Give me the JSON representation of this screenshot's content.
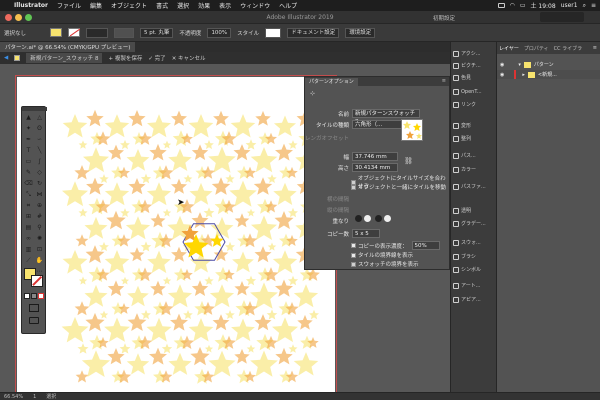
{
  "menubar": {
    "app_name": "Illustrator",
    "items": [
      "ファイル",
      "編集",
      "オブジェクト",
      "書式",
      "選択",
      "効果",
      "表示",
      "ウィンドウ",
      "ヘルプ"
    ],
    "clock": "土 19:08",
    "user": "user1"
  },
  "window": {
    "title": "Adobe Illustrator 2019"
  },
  "control_bar": {
    "selection_label": "選択なし",
    "stroke_weight": "5 pt. 丸筆",
    "opacity_label": "不透明度",
    "opacity_value": "100%",
    "style_label": "スタイル",
    "doc_setup": "ドキュメント設定",
    "prefs": "環境設定",
    "workspace": "初期設定"
  },
  "document_tab": {
    "title": "パターン.ai* @ 66.54% (CMYK/GPU プレビュー)"
  },
  "isolation_bar": {
    "pattern_name": "新規パターン_スウォッチ 8",
    "save_copy": "+ 複製を保存",
    "done": "✓ 完了",
    "cancel": "✕ キャンセル"
  },
  "pattern_options": {
    "tab_label": "パターンオプション",
    "name_label": "名前",
    "name_value": "新規パターンスウォッチ 8",
    "tile_type_label": "タイルの種類",
    "tile_type_value": "六角形（...",
    "brick_offset_label": "レンガオフセット",
    "width_label": "幅",
    "width_value": "37.746 mm",
    "height_label": "高さ",
    "height_value": "30.4134 mm",
    "size_tile_check": "オブジェクトにタイルサイズを合わせる",
    "move_tile_check": "オブジェクトと一緒にタイルを移動",
    "h_spacing_label": "横の間隔",
    "v_spacing_label": "縦の間隔",
    "overlap_label": "重なり",
    "copies_label": "コピー数",
    "copies_value": "5 x 5",
    "dim_copies_check": "コピーの表示濃度：",
    "dim_value": "50%",
    "show_tile_edge": "タイルの境界線を表示",
    "show_swatch_bounds": "スウォッチの境界を表示"
  },
  "dock": {
    "items": [
      "アクシ...",
      "ピクチ...",
      "色見",
      "OpenT...",
      "リンク",
      "変形",
      "整列",
      "パス...",
      "カラー",
      "パスファ...",
      "透明",
      "グラデー...",
      "スウォ...",
      "ブラシ",
      "シンボル",
      "アート...",
      "アピア..."
    ]
  },
  "layers": {
    "tabs": [
      "レイヤー",
      "プロパティ",
      "CC ライブラ"
    ],
    "rows": [
      {
        "name": "パターン"
      },
      {
        "name": "<新規..."
      }
    ]
  },
  "status": {
    "zoom": "66.54%",
    "artboard": "1",
    "tool": "選択"
  },
  "colors": {
    "accent_blue": "#3a8ee6",
    "star_yellow": "#ffd700",
    "star_pale": "#f7e36e",
    "star_orange": "#f0a23c",
    "tile_border": "#4b4ba6"
  }
}
